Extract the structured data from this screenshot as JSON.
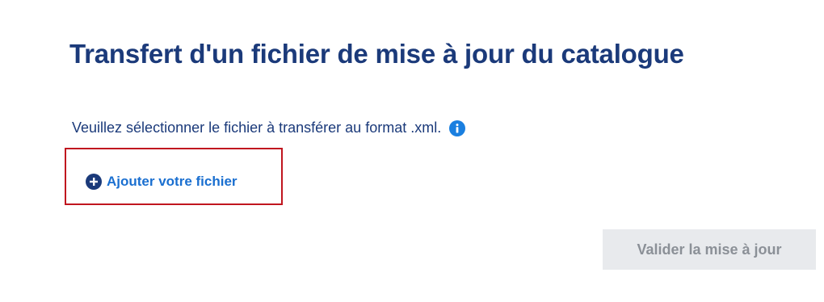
{
  "page": {
    "title": "Transfert d'un fichier de mise à jour du catalogue"
  },
  "upload": {
    "instruction": "Veuillez sélectionner le fichier à transférer au format .xml.",
    "info_icon": "info-circle-icon",
    "add_file_icon": "plus-circle-icon",
    "add_file_label": "Ajouter votre fichier"
  },
  "actions": {
    "validate_label": "Valider la mise à jour",
    "validate_disabled": true
  },
  "colors": {
    "title": "#1b3a7a",
    "link": "#1a6fd0",
    "info_icon": "#1a7fe0",
    "highlight_border": "#c0161f",
    "disabled_button_bg": "#e8eaed",
    "disabled_button_text": "#8b9097"
  }
}
